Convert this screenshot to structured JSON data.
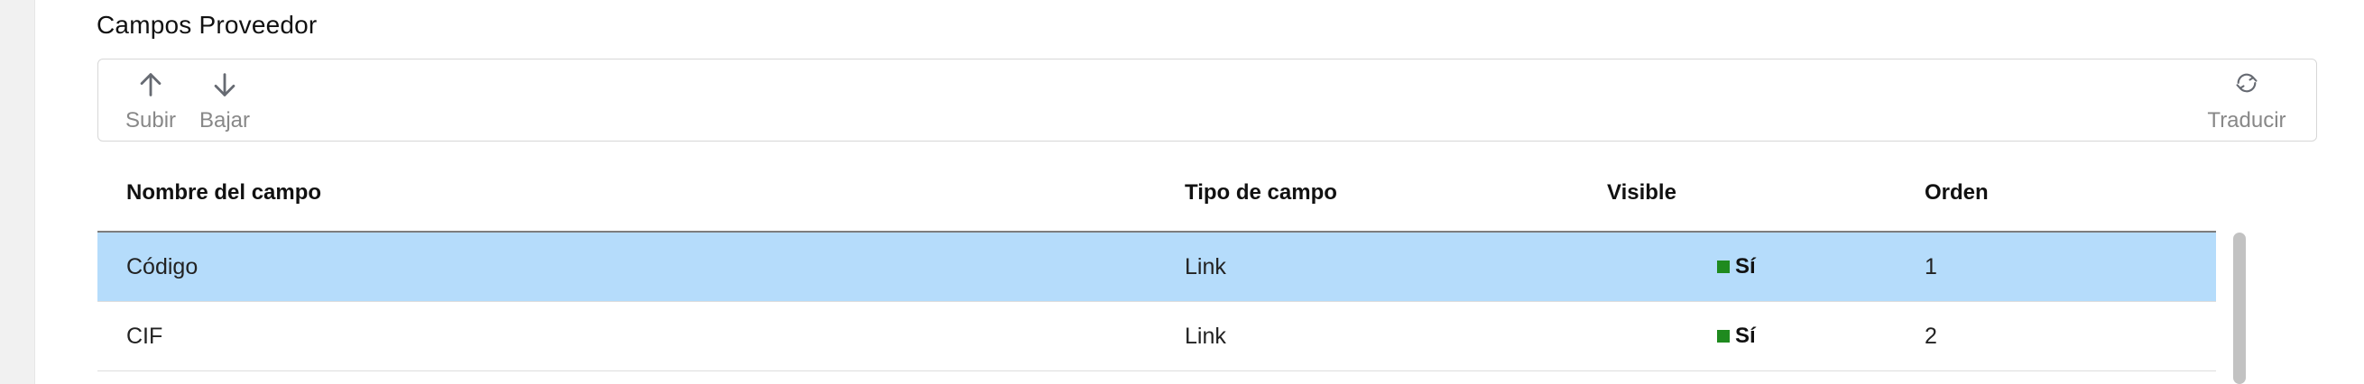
{
  "section": {
    "title": "Campos Proveedor"
  },
  "toolbar": {
    "up": {
      "label": "Subir",
      "icon": "arrow-up-icon"
    },
    "down": {
      "label": "Bajar",
      "icon": "arrow-down-icon"
    },
    "translate": {
      "label": "Traducir",
      "icon": "refresh-icon"
    }
  },
  "table": {
    "columns": [
      "Nombre del campo",
      "Tipo de campo",
      "Visible",
      "Orden"
    ],
    "rows": [
      {
        "name": "Código",
        "type": "Link",
        "visible": "Sí",
        "order": "1",
        "selected": true
      },
      {
        "name": "CIF",
        "type": "Link",
        "visible": "Sí",
        "order": "2",
        "selected": false
      }
    ]
  },
  "colors": {
    "selected_row": "#b5dcfb",
    "visible_indicator": "#1f8a1f"
  }
}
